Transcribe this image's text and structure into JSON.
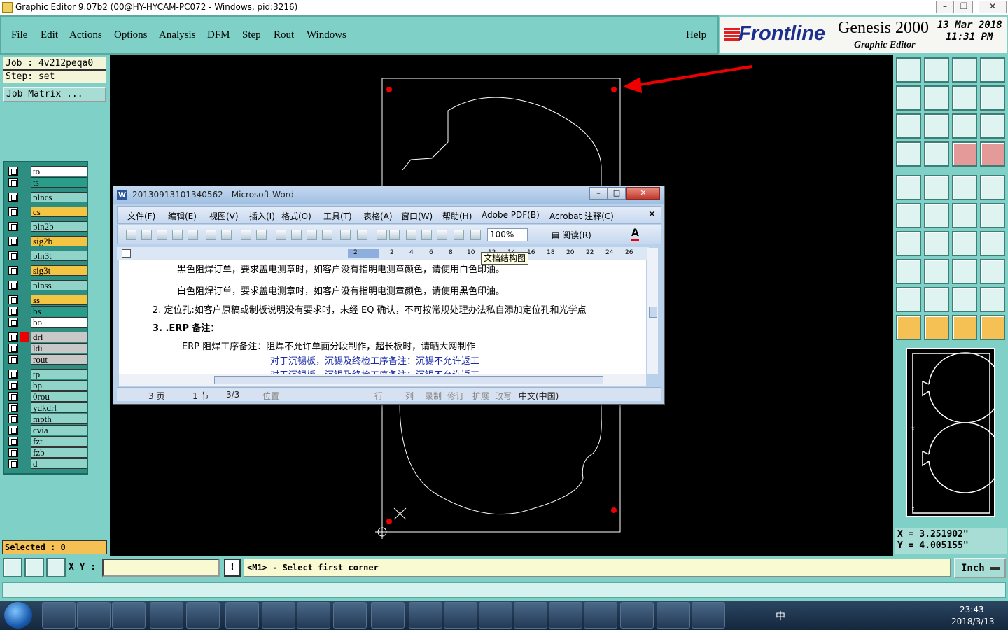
{
  "window": {
    "title": "Graphic Editor 9.07b2 (00@HY-HYCAM-PC072 - Windows, pid:3216)"
  },
  "menu": {
    "items": [
      "File",
      "Edit",
      "Actions",
      "Options",
      "Analysis",
      "DFM",
      "Step",
      "Rout",
      "Windows"
    ],
    "help": "Help"
  },
  "brand": {
    "logo": "Frontline",
    "product": "Genesis 2000",
    "subtitle": "Graphic Editor",
    "date": "13 Mar 2018",
    "time": "11:31 PM"
  },
  "job": {
    "job_label": "Job : 4v212peqa0",
    "step_label": "Step: set",
    "matrix_button": "Job Matrix ..."
  },
  "layers": [
    {
      "name": "to",
      "color": "#ffffff"
    },
    {
      "name": "ts",
      "color": "#2a9d8a"
    },
    {
      "name": "plncs",
      "color": "#8fd3c9"
    },
    {
      "name": "cs",
      "color": "#f4c542"
    },
    {
      "name": "pln2b",
      "color": "#8fd3c9"
    },
    {
      "name": "sig2b",
      "color": "#f4c542"
    },
    {
      "name": "pln3t",
      "color": "#8fd3c9"
    },
    {
      "name": "sig3t",
      "color": "#f4c542"
    },
    {
      "name": "plnss",
      "color": "#8fd3c9"
    },
    {
      "name": "ss",
      "color": "#f4c542"
    },
    {
      "name": "bs",
      "color": "#2a9d8a"
    },
    {
      "name": "bo",
      "color": "#ffffff"
    },
    {
      "name": "drl",
      "color": "#c8c8c8"
    },
    {
      "name": "ldi",
      "color": "#c8c8c8"
    },
    {
      "name": "rout",
      "color": "#c8c8c8"
    },
    {
      "name": "tp",
      "color": "#8fd3c9"
    },
    {
      "name": "bp",
      "color": "#8fd3c9"
    },
    {
      "name": "0rou",
      "color": "#8fd3c9"
    },
    {
      "name": "ydkdrl",
      "color": "#8fd3c9"
    },
    {
      "name": "mpth",
      "color": "#8fd3c9"
    },
    {
      "name": "cvia",
      "color": "#8fd3c9"
    },
    {
      "name": "fzt",
      "color": "#8fd3c9"
    },
    {
      "name": "fzb",
      "color": "#8fd3c9"
    },
    {
      "name": "d",
      "color": "#8fd3c9"
    }
  ],
  "selected": "Selected : 0",
  "coords": {
    "x": "X = 3.251902\"",
    "y": "Y = 4.005155\""
  },
  "bottom": {
    "xy_label": "X Y :",
    "prompt": "<M1> - Select first corner",
    "units": "Inch"
  },
  "word": {
    "title": "20130913101340562 - Microsoft Word",
    "menus": [
      "文件(F)",
      "编辑(E)",
      "视图(V)",
      "插入(I)",
      "格式(O)",
      "工具(T)",
      "表格(A)",
      "窗口(W)",
      "帮助(H)",
      "Adobe PDF(B)",
      "Acrobat 注释(C)"
    ],
    "zoom": "100%",
    "read_button": "阅读(R)",
    "tooltip": "文档结构图",
    "ruler": [
      "2",
      "2",
      "4",
      "6",
      "8",
      "10",
      "12",
      "14",
      "16",
      "18",
      "20",
      "22",
      "24",
      "26"
    ],
    "lines": [
      "黑色阻焊订单，要求盖电测章时，如客户没有指明电测章颜色，请使用白色印油。",
      "白色阻焊订单，要求盖电测章时，如客户没有指明电测章颜色，请使用黑色印油。",
      "2.  定位孔:如客户原稿或制板说明没有要求时，未经 EQ 确认，不可按常规处理办法私自添加定位孔和光学点",
      "3. .ERP 备注：",
      "ERP 阻焊工序备注：阻焊不允许单面分段制作，超长板时，请晒大网制作",
      "对于沉锡板，沉锡及终检工序备注：沉锡不允许返工",
      "对于沉银板，沉银及终检工序备注：沉银不允许返工"
    ],
    "status": [
      "3 页",
      "1 节",
      "3/3",
      "位置",
      "行",
      "列",
      "录制",
      "修订",
      "扩展",
      "改写",
      "中文(中国)"
    ]
  },
  "taskbar": {
    "time": "23:43",
    "date": "2018/3/13",
    "ime": "中"
  },
  "colors": {
    "teal": "#7fd1c7",
    "highlight_red": "#ff0000",
    "drawing": "#ffffff"
  }
}
